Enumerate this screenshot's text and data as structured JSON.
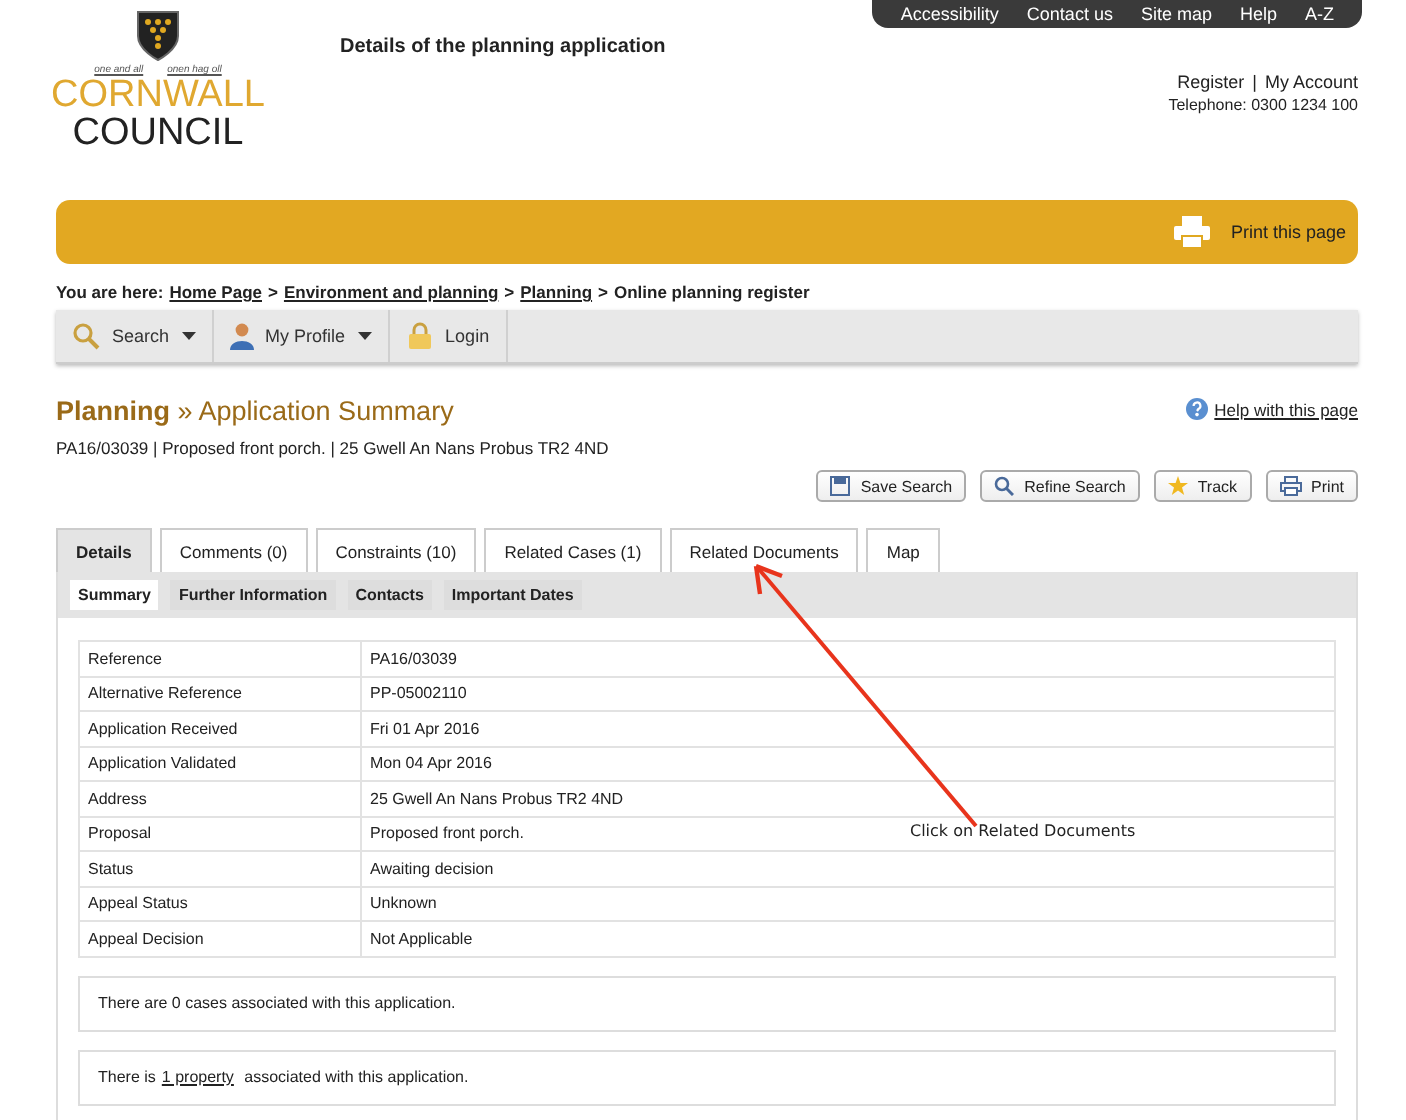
{
  "top_nav": [
    "Accessibility",
    "Contact us",
    "Site map",
    "Help",
    "A-Z"
  ],
  "logo": {
    "motto_left": "one and all",
    "motto_right": "onen hag oll",
    "line1": "CORNWALL",
    "line2": "COUNCIL"
  },
  "page_title": "Details of the planning application",
  "account_links": [
    "Register",
    "My Account"
  ],
  "link_separator": "|",
  "telephone": "Telephone: 0300 1234 100",
  "banner": {
    "print_label": "Print this page"
  },
  "breadcrumb": {
    "label": "You are here:",
    "separator": ">",
    "items": [
      {
        "text": "Home Page",
        "link": true
      },
      {
        "text": "Environment and planning",
        "link": true
      },
      {
        "text": "Planning",
        "link": true
      },
      {
        "text": "Online planning register",
        "link": false
      }
    ]
  },
  "toolbar": [
    {
      "label": "Search",
      "dropdown": true
    },
    {
      "label": "My Profile",
      "dropdown": true
    },
    {
      "label": "Login",
      "dropdown": false
    }
  ],
  "heading": {
    "section": "Planning",
    "separator": "»",
    "title": "Application Summary"
  },
  "help_link": "Help with this page",
  "summary_line": "PA16/03039 | Proposed front porch. | 25 Gwell An Nans Probus TR2 4ND",
  "actions": [
    "Save Search",
    "Refine Search",
    "Track",
    "Print"
  ],
  "tabs": [
    {
      "label": "Details",
      "selected": true
    },
    {
      "label": "Comments (0)",
      "selected": false
    },
    {
      "label": "Constraints (10)",
      "selected": false
    },
    {
      "label": "Related Cases (1)",
      "selected": false
    },
    {
      "label": "Related Documents",
      "selected": false
    },
    {
      "label": "Map",
      "selected": false
    }
  ],
  "subtabs": [
    {
      "label": "Summary",
      "selected": true
    },
    {
      "label": "Further Information",
      "selected": false
    },
    {
      "label": "Contacts",
      "selected": false
    },
    {
      "label": "Important Dates",
      "selected": false
    }
  ],
  "details": [
    {
      "label": "Reference",
      "value": "PA16/03039"
    },
    {
      "label": "Alternative Reference",
      "value": "PP-05002110"
    },
    {
      "label": "Application Received",
      "value": "Fri 01 Apr 2016"
    },
    {
      "label": "Application Validated",
      "value": "Mon 04 Apr 2016"
    },
    {
      "label": "Address",
      "value": "25 Gwell An Nans Probus TR2 4ND"
    },
    {
      "label": "Proposal",
      "value": "Proposed front porch."
    },
    {
      "label": "Status",
      "value": "Awaiting decision"
    },
    {
      "label": "Appeal Status",
      "value": "Unknown"
    },
    {
      "label": "Appeal Decision",
      "value": "Not Applicable"
    }
  ],
  "notes": [
    {
      "before": "There are 0 cases associated with this application."
    },
    {
      "before": "There is",
      "link": "1 property",
      "after": "associated with this application."
    }
  ],
  "annotation": {
    "text": "Click on Related Documents"
  }
}
